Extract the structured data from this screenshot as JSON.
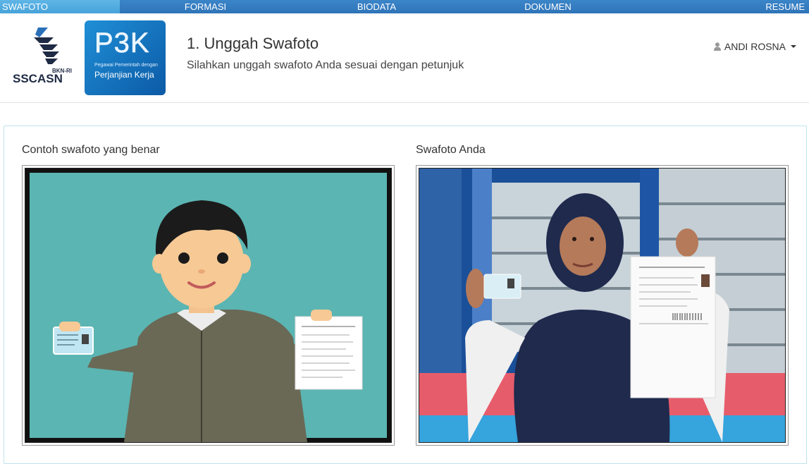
{
  "steps": [
    {
      "label": "SWAFOTO",
      "active": true
    },
    {
      "label": "FORMASI",
      "active": false
    },
    {
      "label": "BIODATA",
      "active": false
    },
    {
      "label": "DOKUMEN",
      "active": false
    },
    {
      "label": "RESUME",
      "active": false
    }
  ],
  "header": {
    "logo_ssc": {
      "top": "BKN-RI",
      "text": "SSCASN"
    },
    "logo_p3k": {
      "mark": "P3K",
      "sub": "Pegawai Pemerintah dengan",
      "sub2": "Perjanjian Kerja"
    },
    "title": "1. Unggah Swafoto",
    "subtitle": "Silahkan unggah swafoto Anda sesuai dengan petunjuk",
    "user": "ANDI ROSNA",
    "user_icon": "user-icon"
  },
  "panel": {
    "example_title": "Contoh swafoto yang benar",
    "yours_title": "Swafoto Anda"
  },
  "colors": {
    "stepbar": "#2f74b8",
    "step_active": "#47a3d9",
    "panel_border": "#bfe3ee",
    "illustration_bg": "#5bb5b2"
  }
}
